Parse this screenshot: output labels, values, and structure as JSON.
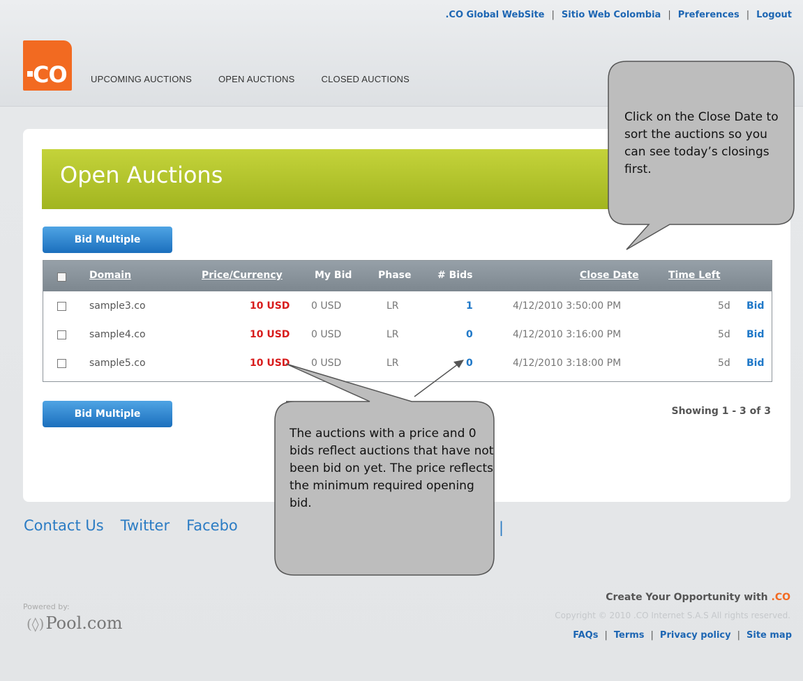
{
  "header": {
    "top_links": [
      ".CO Global WebSite",
      "Sitio Web Colombia",
      "Preferences",
      "Logout"
    ],
    "logo_text": "CO",
    "nav": [
      "UPCOMING AUCTIONS",
      "OPEN AUCTIONS",
      "CLOSED AUCTIONS"
    ]
  },
  "main": {
    "title": "Open Auctions",
    "bid_multiple_label": "Bid Multiple",
    "showing": "Showing 1 - 3 of 3",
    "table": {
      "columns": [
        "Domain",
        "Price/Currency",
        "My Bid",
        "Phase",
        "# Bids",
        "Close Date",
        "Time Left"
      ],
      "rows": [
        {
          "domain": "sample3.co",
          "price": "10 USD",
          "my_bid": "0 USD",
          "phase": "LR",
          "bids": "1",
          "close_date": "4/12/2010 3:50:00 PM",
          "time_left": "5d",
          "action": "Bid"
        },
        {
          "domain": "sample4.co",
          "price": "10 USD",
          "my_bid": "0 USD",
          "phase": "LR",
          "bids": "0",
          "close_date": "4/12/2010 3:16:00 PM",
          "time_left": "5d",
          "action": "Bid"
        },
        {
          "domain": "sample5.co",
          "price": "10 USD",
          "my_bid": "0 USD",
          "phase": "LR",
          "bids": "0",
          "close_date": "4/12/2010 3:18:00 PM",
          "time_left": "5d",
          "action": "Bid"
        }
      ]
    }
  },
  "callouts": {
    "close_date": "Click on the Close Date to sort the auctions so you can see today’s closings first.",
    "zero_bids": "The auctions with a price and 0 bids reflect auctions that have not been bid on yet.  The price reflects the minimum required opening bid."
  },
  "footer": {
    "links": [
      "Contact Us",
      "Twitter",
      "Facebo"
    ],
    "powered_by": "Powered by:",
    "pool_com": "Pool.com",
    "tagline_prefix": "Create Your Opportunity with",
    "tagline_brand": ".CO",
    "copyright": "Copyright © 2010 .CO Internet S.A.S All rights reserved.",
    "bottom_links": [
      "FAQs",
      "Terms",
      "Privacy policy",
      "Site map"
    ]
  },
  "colors": {
    "brand_orange": "#f26a21",
    "link_blue": "#1d66b3",
    "price_red": "#d81c1c",
    "banner_green": "#b3c42b",
    "button_blue": "#1b6fbd"
  }
}
